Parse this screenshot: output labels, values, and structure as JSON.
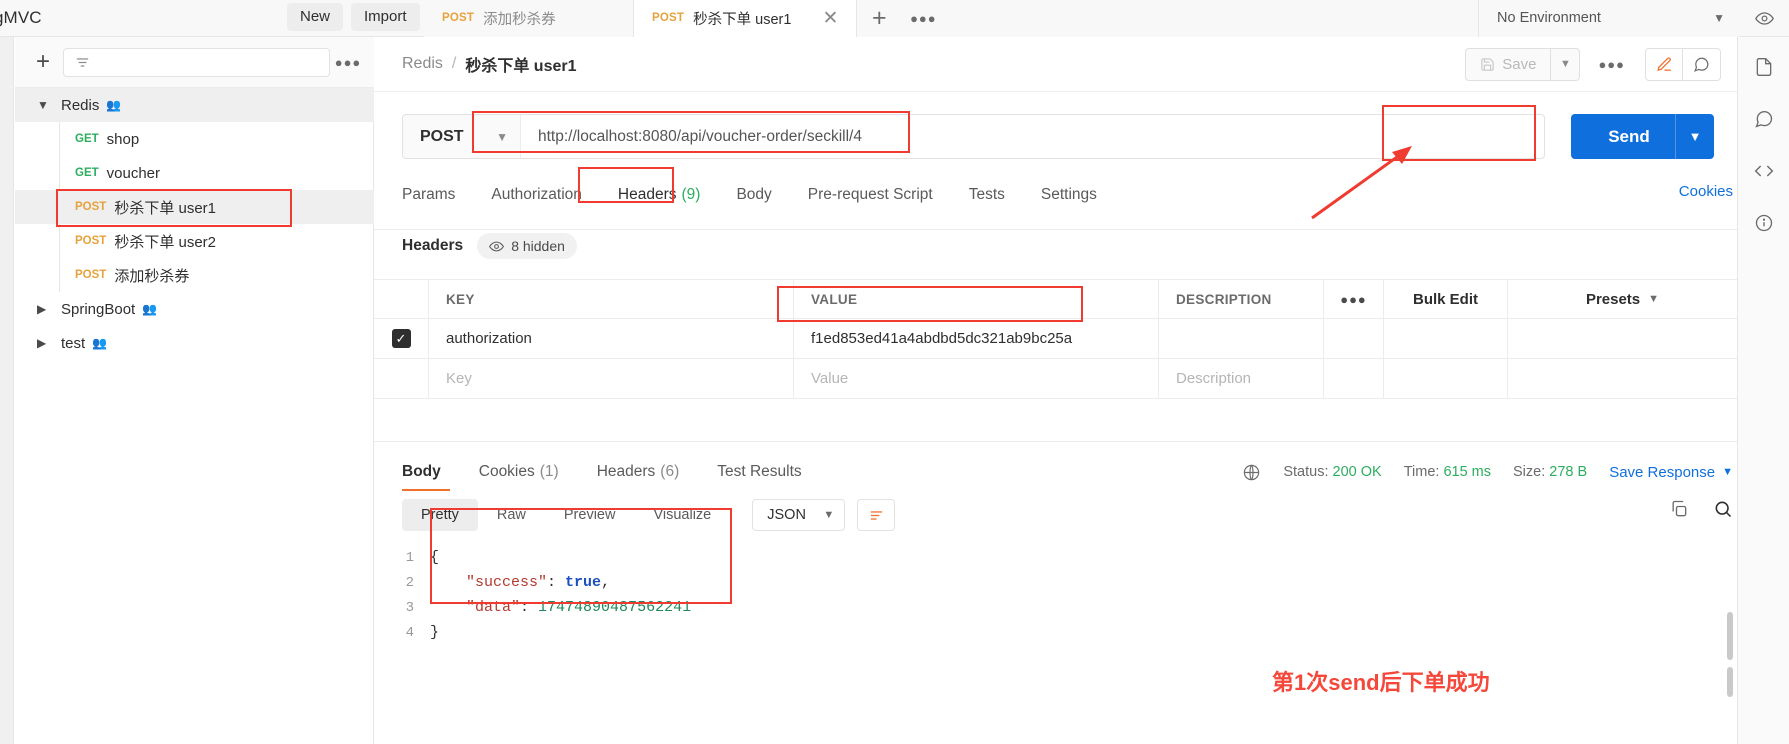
{
  "app": {
    "title": "gMVC"
  },
  "topbar": {
    "new_label": "New",
    "import_label": "Import",
    "tabs": [
      {
        "method": "POST",
        "label": "添加秒杀券",
        "active": false
      },
      {
        "method": "POST",
        "label": "秒杀下单 user1",
        "active": true
      }
    ],
    "add_tab_icon": "plus-icon",
    "more_tabs_icon": "ellipsis-icon",
    "environment": "No Environment",
    "env_caret_icon": "chevron-down-icon",
    "eye_icon": "eye-icon"
  },
  "sidebar": {
    "filter_placeholder": "",
    "new_icon": "plus-icon",
    "filter_icon": "filter-icon",
    "more_icon": "ellipsis-icon",
    "tree": [
      {
        "type": "folder",
        "name": "Redis",
        "expanded": true,
        "selected": true,
        "share_icon": "share-people-icon"
      },
      {
        "type": "request",
        "method": "GET",
        "name": "shop",
        "highlighted": false
      },
      {
        "type": "request",
        "method": "GET",
        "name": "voucher",
        "highlighted": false
      },
      {
        "type": "request",
        "method": "POST",
        "name": "秒杀下单 user1",
        "highlighted": true
      },
      {
        "type": "request",
        "method": "POST",
        "name": "秒杀下单 user2",
        "highlighted": false
      },
      {
        "type": "request",
        "method": "POST",
        "name": "添加秒杀券",
        "highlighted": false
      },
      {
        "type": "folder",
        "name": "SpringBoot",
        "expanded": false,
        "selected": false,
        "share_icon": "share-people-icon"
      },
      {
        "type": "folder",
        "name": "test",
        "expanded": false,
        "selected": false,
        "share_icon": "share-people-icon"
      }
    ]
  },
  "request": {
    "breadcrumb_root": "Redis",
    "breadcrumb_sep": "/",
    "breadcrumb_current": "秒杀下单 user1",
    "save_label": "Save",
    "save_icon": "save-disk-icon",
    "save_caret_icon": "chevron-down-icon",
    "more_icon": "ellipsis-icon",
    "edit_icon": "pencil-icon",
    "comment_icon": "comment-icon",
    "method": "POST",
    "method_caret_icon": "chevron-down-icon",
    "url": "http://localhost:8080/api/voucher-order/seckill/4",
    "send_label": "Send",
    "send_caret_icon": "chevron-down-icon",
    "tabs": [
      {
        "label": "Params",
        "count": "",
        "active": false
      },
      {
        "label": "Authorization",
        "count": "",
        "active": false
      },
      {
        "label": "Headers",
        "count": "(9)",
        "active": true
      },
      {
        "label": "Body",
        "count": "",
        "active": false
      },
      {
        "label": "Pre-request Script",
        "count": "",
        "active": false
      },
      {
        "label": "Tests",
        "count": "",
        "active": false
      },
      {
        "label": "Settings",
        "count": "",
        "active": false
      }
    ],
    "cookies_link": "Cookies"
  },
  "headers_panel": {
    "title": "Headers",
    "hidden_label": "8 hidden",
    "hidden_icon": "eye-icon",
    "columns": [
      "KEY",
      "VALUE",
      "DESCRIPTION"
    ],
    "column_more_icon": "ellipsis-icon",
    "bulk_edit_label": "Bulk Edit",
    "presets_label": "Presets",
    "presets_caret_icon": "chevron-down-icon",
    "rows": [
      {
        "checked": true,
        "check_icon": "checkmark-icon",
        "key": "authorization",
        "value": "f1ed853ed41a4abdbd5dc321ab9bc25a",
        "description": ""
      }
    ],
    "empty_row": {
      "key_placeholder": "Key",
      "value_placeholder": "Value",
      "description_placeholder": "Description"
    }
  },
  "response": {
    "tabs": [
      {
        "label": "Body",
        "count": "",
        "active": true
      },
      {
        "label": "Cookies",
        "count": "(1)",
        "active": false
      },
      {
        "label": "Headers",
        "count": "(6)",
        "active": false
      },
      {
        "label": "Test Results",
        "count": "",
        "active": false
      }
    ],
    "globe_icon": "globe-icon",
    "status_label": "Status:",
    "status_value": "200 OK",
    "time_label": "Time:",
    "time_value": "615 ms",
    "size_label": "Size:",
    "size_value": "278 B",
    "save_response_label": "Save Response",
    "save_response_caret_icon": "chevron-down-icon",
    "viewer_modes": [
      {
        "label": "Pretty",
        "active": true
      },
      {
        "label": "Raw",
        "active": false
      },
      {
        "label": "Preview",
        "active": false
      },
      {
        "label": "Visualize",
        "active": false
      }
    ],
    "format": "JSON",
    "format_caret_icon": "chevron-down-icon",
    "wrap_icon": "wrap-lines-icon",
    "copy_icon": "copy-icon",
    "search_icon": "search-icon",
    "body_lines": [
      {
        "num": "1",
        "tokens": [
          {
            "t": "{",
            "c": "punct"
          }
        ]
      },
      {
        "num": "2",
        "tokens": [
          {
            "t": "    ",
            "c": "punct"
          },
          {
            "t": "\"success\"",
            "c": "key"
          },
          {
            "t": ": ",
            "c": "punct"
          },
          {
            "t": "true",
            "c": "bool"
          },
          {
            "t": ",",
            "c": "punct"
          }
        ]
      },
      {
        "num": "3",
        "tokens": [
          {
            "t": "    ",
            "c": "punct"
          },
          {
            "t": "\"data\"",
            "c": "key"
          },
          {
            "t": ": ",
            "c": "punct"
          },
          {
            "t": "17474890487562241",
            "c": "num"
          }
        ]
      },
      {
        "num": "4",
        "tokens": [
          {
            "t": "}",
            "c": "punct"
          }
        ]
      }
    ]
  },
  "annotation": {
    "text": "第1次send后下单成功",
    "color": "#f5483b"
  },
  "right_rail": {
    "items": [
      "doc-icon",
      "comment-icon",
      "code-icon",
      "info-icon"
    ]
  },
  "colors": {
    "accent_blue": "#0f6fdd",
    "method_post": "#e6a23c",
    "method_get": "#2dae5f",
    "status_green": "#2dae5f",
    "annotation_red": "#ef3b30",
    "orange_active": "#f0702a"
  }
}
